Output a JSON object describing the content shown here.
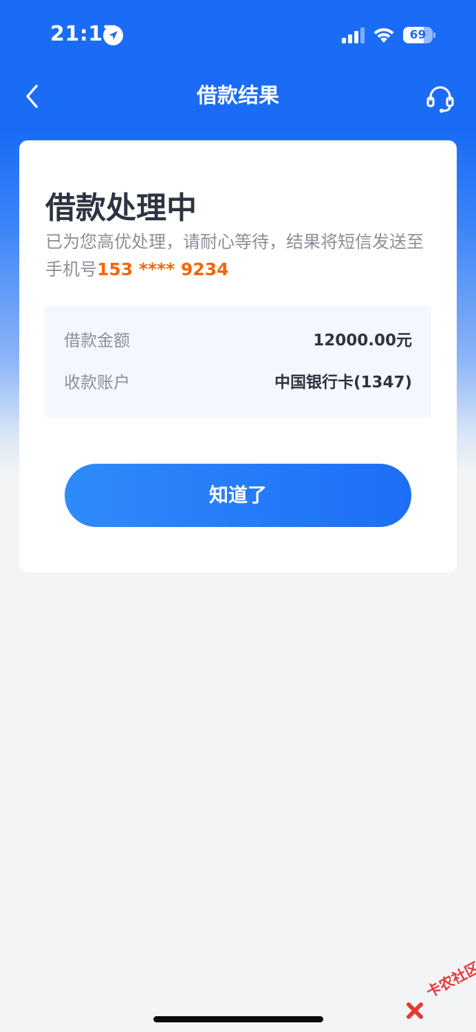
{
  "status_bar": {
    "time": "21:17",
    "battery": "69",
    "battery_level": 0.69
  },
  "nav": {
    "title": "借款结果",
    "back_icon": "chevron-left-icon",
    "service_icon": "headset-icon"
  },
  "card": {
    "title": "借款处理中",
    "desc_prefix": "已为您高优处理，请耐心等待，结果将短信发送至手机号",
    "phone": "153 **** 9234",
    "rows": [
      {
        "label": "借款金额",
        "value": "12000.00元"
      },
      {
        "label": "收款账户",
        "value": "中国银行卡(1347)"
      }
    ],
    "button_label": "知道了"
  },
  "watermark": "卡农社区",
  "colors": {
    "primary": "#1a6cf6",
    "accent": "#f5640a",
    "title_text": "#2d3340",
    "muted_text": "#8a8f99"
  }
}
